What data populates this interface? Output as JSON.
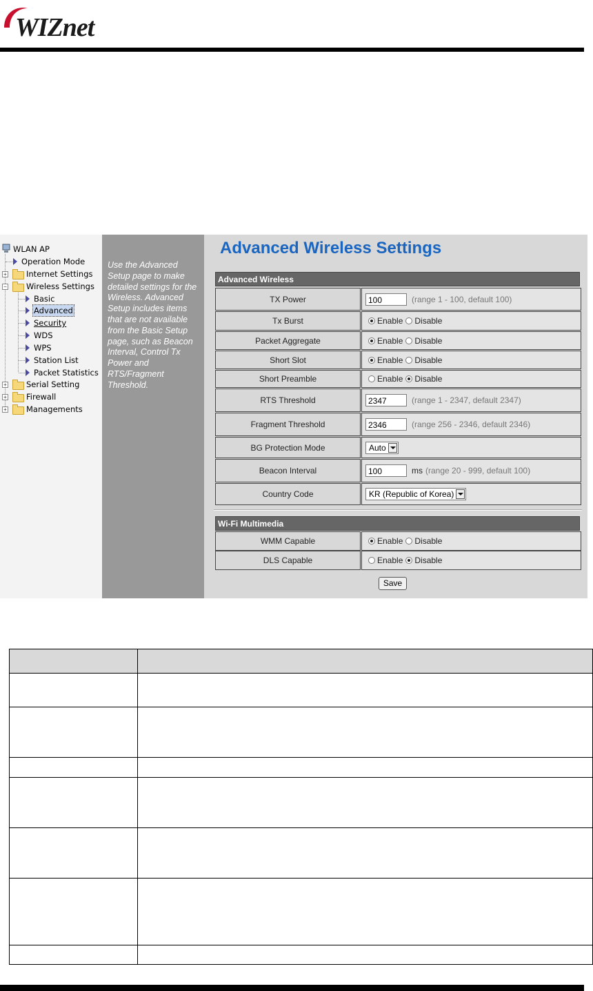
{
  "brand": {
    "logo_text": "WIZnet"
  },
  "tree": {
    "root": "WLAN AP",
    "items": [
      {
        "label": "Operation Mode",
        "level": 1,
        "kind": "leaf"
      },
      {
        "label": "Internet Settings",
        "level": 1,
        "kind": "folder"
      },
      {
        "label": "Wireless Settings",
        "level": 1,
        "kind": "folder-open"
      },
      {
        "label": "Basic",
        "level": 2,
        "kind": "leaf"
      },
      {
        "label": "Advanced",
        "level": 2,
        "kind": "leaf",
        "selected": true
      },
      {
        "label": "Security",
        "level": 2,
        "kind": "leaf"
      },
      {
        "label": "WDS",
        "level": 2,
        "kind": "leaf"
      },
      {
        "label": "WPS",
        "level": 2,
        "kind": "leaf"
      },
      {
        "label": "Station List",
        "level": 2,
        "kind": "leaf"
      },
      {
        "label": "Packet Statistics",
        "level": 2,
        "kind": "leaf"
      },
      {
        "label": "Serial Setting",
        "level": 1,
        "kind": "folder"
      },
      {
        "label": "Firewall",
        "level": 1,
        "kind": "folder"
      },
      {
        "label": "Managements",
        "level": 1,
        "kind": "folder"
      }
    ]
  },
  "help": {
    "text": "Use the Advanced Setup page to make detailed settings for the Wireless. Advanced Setup includes items that are not available from the Basic Setup page, such as Beacon Interval, Control Tx Power and RTS/Fragment Threshold."
  },
  "main": {
    "title": "Advanced Wireless Settings",
    "section1": "Advanced Wireless",
    "section2": "Wi-Fi Multimedia",
    "radio_enable": "Enable",
    "radio_disable": "Disable",
    "tx_power": {
      "label": "TX Power",
      "value": "100",
      "hint": "(range 1 - 100, default 100)"
    },
    "tx_burst": {
      "label": "Tx Burst",
      "selected": "Enable"
    },
    "packet_aggregate": {
      "label": "Packet Aggregate",
      "selected": "Enable"
    },
    "short_slot": {
      "label": "Short Slot",
      "selected": "Enable"
    },
    "short_preamble": {
      "label": "Short Preamble",
      "selected": "Disable"
    },
    "rts_threshold": {
      "label": "RTS Threshold",
      "value": "2347",
      "hint": "(range 1 - 2347, default 2347)"
    },
    "fragment_threshold": {
      "label": "Fragment Threshold",
      "value": "2346",
      "hint": "(range 256 - 2346, default 2346)"
    },
    "bg_protection": {
      "label": "BG Protection Mode",
      "value": "Auto"
    },
    "beacon_interval": {
      "label": "Beacon Interval",
      "value": "100",
      "unit": "ms",
      "hint": "(range 20 - 999, default 100)"
    },
    "country_code": {
      "label": "Country Code",
      "value": "KR (Republic of Korea)"
    },
    "wmm_capable": {
      "label": "WMM Capable",
      "selected": "Enable"
    },
    "dls_capable": {
      "label": "DLS Capable",
      "selected": "Disable"
    },
    "save_label": "Save"
  }
}
